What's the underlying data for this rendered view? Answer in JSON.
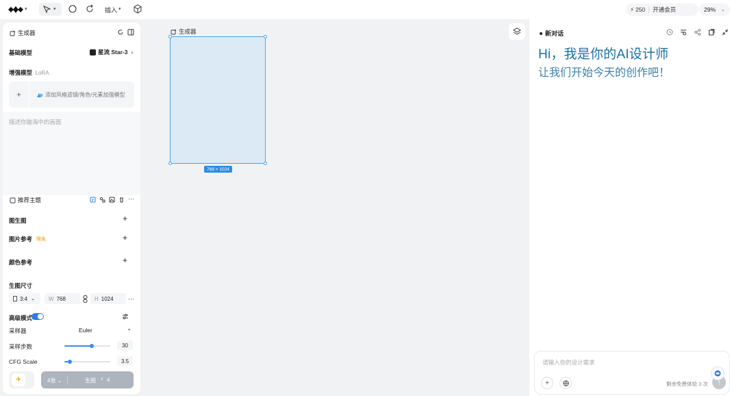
{
  "topbar": {
    "insert_label": "插入",
    "credits": "250",
    "membership": "开通会员",
    "zoom": "29%"
  },
  "generator": {
    "panel_title": "生成器",
    "base_model_label": "基础模型",
    "base_model_value": "星流 Star-3",
    "enhance_label": "增强模型",
    "enhance_sub": "LoRA",
    "lora_add_text": "添加风格滤镜/角色/元素加强模型",
    "prompt_placeholder": "描述你脑海中的画面",
    "recommend_label": "推荐主题",
    "img2img_label": "图生图",
    "image_ref_label": "图片参考",
    "image_ref_badge": "限免",
    "color_ref_label": "颜色参考",
    "size_label": "生图尺寸",
    "ratio": "3:4",
    "width_prefix": "W",
    "width": "768",
    "height_prefix": "H",
    "height": "1024",
    "advanced_label": "高级模式",
    "sampler_label": "采样器",
    "sampler_value": "Euler",
    "steps_label": "采样步数",
    "steps": 30,
    "steps_max": 50,
    "cfg_label": "CFG Scale",
    "cfg": 3.5,
    "cfg_max": 30,
    "count_label": "4张",
    "generate_label": "生图",
    "generate_cost": "4"
  },
  "canvas": {
    "frame_title": "生成器",
    "frame_size": "768 × 1024"
  },
  "chat": {
    "title": "新对话",
    "greeting_line1": "Hi，我是你的AI设计师",
    "greeting_line2": "让我们开始今天的创作吧！",
    "input_placeholder": "请输入你的设计需求",
    "free_trial": "剩余免费体验 3 次"
  },
  "colors": {
    "accent": "#2f7de1",
    "frame_fill": "#dbeaf5",
    "greeting": "#1a6fa0"
  }
}
